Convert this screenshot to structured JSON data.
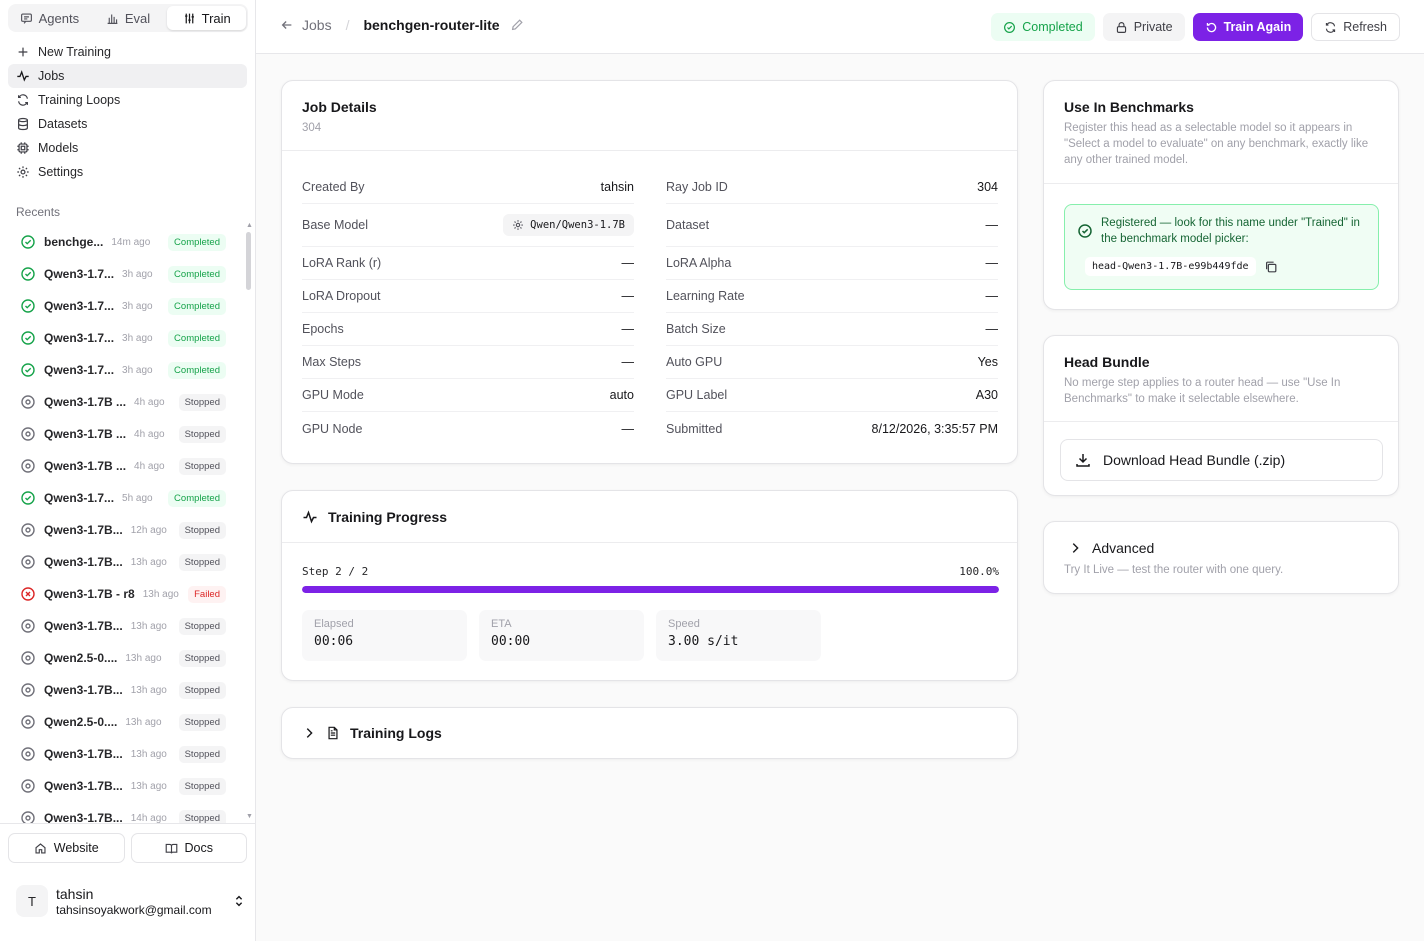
{
  "modes": {
    "agents": "Agents",
    "eval": "Eval",
    "train": "Train"
  },
  "nav": [
    {
      "label": "New Training",
      "icon": "plus-icon"
    },
    {
      "label": "Jobs",
      "icon": "activity-icon",
      "active": true
    },
    {
      "label": "Training Loops",
      "icon": "refresh-icon"
    },
    {
      "label": "Datasets",
      "icon": "database-icon"
    },
    {
      "label": "Models",
      "icon": "cpu-icon"
    },
    {
      "label": "Settings",
      "icon": "gear-icon"
    }
  ],
  "recents_label": "Recents",
  "recents": [
    {
      "name": "benchge...",
      "ago": "14m ago",
      "status": "Completed"
    },
    {
      "name": "Qwen3-1.7...",
      "ago": "3h ago",
      "status": "Completed"
    },
    {
      "name": "Qwen3-1.7...",
      "ago": "3h ago",
      "status": "Completed"
    },
    {
      "name": "Qwen3-1.7...",
      "ago": "3h ago",
      "status": "Completed"
    },
    {
      "name": "Qwen3-1.7...",
      "ago": "3h ago",
      "status": "Completed"
    },
    {
      "name": "Qwen3-1.7B ...",
      "ago": "4h ago",
      "status": "Stopped"
    },
    {
      "name": "Qwen3-1.7B ...",
      "ago": "4h ago",
      "status": "Stopped"
    },
    {
      "name": "Qwen3-1.7B ...",
      "ago": "4h ago",
      "status": "Stopped"
    },
    {
      "name": "Qwen3-1.7...",
      "ago": "5h ago",
      "status": "Completed"
    },
    {
      "name": "Qwen3-1.7B...",
      "ago": "12h ago",
      "status": "Stopped"
    },
    {
      "name": "Qwen3-1.7B...",
      "ago": "13h ago",
      "status": "Stopped"
    },
    {
      "name": "Qwen3-1.7B - r8",
      "ago": "13h ago",
      "status": "Failed"
    },
    {
      "name": "Qwen3-1.7B...",
      "ago": "13h ago",
      "status": "Stopped"
    },
    {
      "name": "Qwen2.5-0....",
      "ago": "13h ago",
      "status": "Stopped"
    },
    {
      "name": "Qwen3-1.7B...",
      "ago": "13h ago",
      "status": "Stopped"
    },
    {
      "name": "Qwen2.5-0....",
      "ago": "13h ago",
      "status": "Stopped"
    },
    {
      "name": "Qwen3-1.7B...",
      "ago": "13h ago",
      "status": "Stopped"
    },
    {
      "name": "Qwen3-1.7B...",
      "ago": "13h ago",
      "status": "Stopped"
    },
    {
      "name": "Qwen3-1.7B...",
      "ago": "14h ago",
      "status": "Stopped"
    }
  ],
  "bottom_links": {
    "website": "Website",
    "docs": "Docs"
  },
  "user": {
    "initial": "T",
    "name": "tahsin",
    "email": "tahsinsoyakwork@gmail.com"
  },
  "breadcrumb": {
    "back": "Jobs",
    "separator": "/",
    "current": "benchgen-router-lite"
  },
  "actions": {
    "status": "Completed",
    "private": "Private",
    "train_again": "Train Again",
    "refresh": "Refresh"
  },
  "job": {
    "title": "Job Details",
    "id": "304",
    "left": [
      {
        "k": "Created By",
        "v": "tahsin"
      },
      {
        "k": "Base Model",
        "v": "Qwen/Qwen3-1.7B",
        "chip": true
      },
      {
        "k": "LoRA Rank (r)",
        "v": "—"
      },
      {
        "k": "LoRA Dropout",
        "v": "—"
      },
      {
        "k": "Epochs",
        "v": "—"
      },
      {
        "k": "Max Steps",
        "v": "—"
      },
      {
        "k": "GPU Mode",
        "v": "auto"
      },
      {
        "k": "GPU Node",
        "v": "—"
      }
    ],
    "right": [
      {
        "k": "Ray Job ID",
        "v": "304"
      },
      {
        "k": "Dataset",
        "v": "—"
      },
      {
        "k": "LoRA Alpha",
        "v": "—"
      },
      {
        "k": "Learning Rate",
        "v": "—"
      },
      {
        "k": "Batch Size",
        "v": "—"
      },
      {
        "k": "Auto GPU",
        "v": "Yes"
      },
      {
        "k": "GPU Label",
        "v": "A30"
      },
      {
        "k": "Submitted",
        "v": "8/12/2026, 3:35:57 PM"
      }
    ]
  },
  "progress": {
    "title": "Training Progress",
    "step": "Step 2 / 2",
    "percent_label": "100.0%",
    "fraction": 1.0,
    "stats": [
      {
        "label": "Elapsed",
        "value": "00:06"
      },
      {
        "label": "ETA",
        "value": "00:00"
      },
      {
        "label": "Speed",
        "value": "3.00 s/it"
      }
    ]
  },
  "logs": {
    "title": "Training Logs"
  },
  "benchmarks": {
    "title": "Use In Benchmarks",
    "desc": "Register this head as a selectable model so it appears in \"Select a model to evaluate\" on any benchmark, exactly like any other trained model.",
    "registered": "Registered — look for this name under \"Trained\" in the benchmark model picker:",
    "code": "head-Qwen3-1.7B-e99b449fde"
  },
  "bundle": {
    "title": "Head Bundle",
    "desc": "No merge step applies to a router head — use \"Use In Benchmarks\" to make it selectable elsewhere.",
    "download": "Download Head Bundle (.zip)"
  },
  "advanced": {
    "title": "Advanced",
    "desc": "Try It Live — test the router with one query."
  },
  "colors": {
    "accent": "#7c22e6",
    "success": "#16a34a",
    "failed": "#dc2626"
  }
}
